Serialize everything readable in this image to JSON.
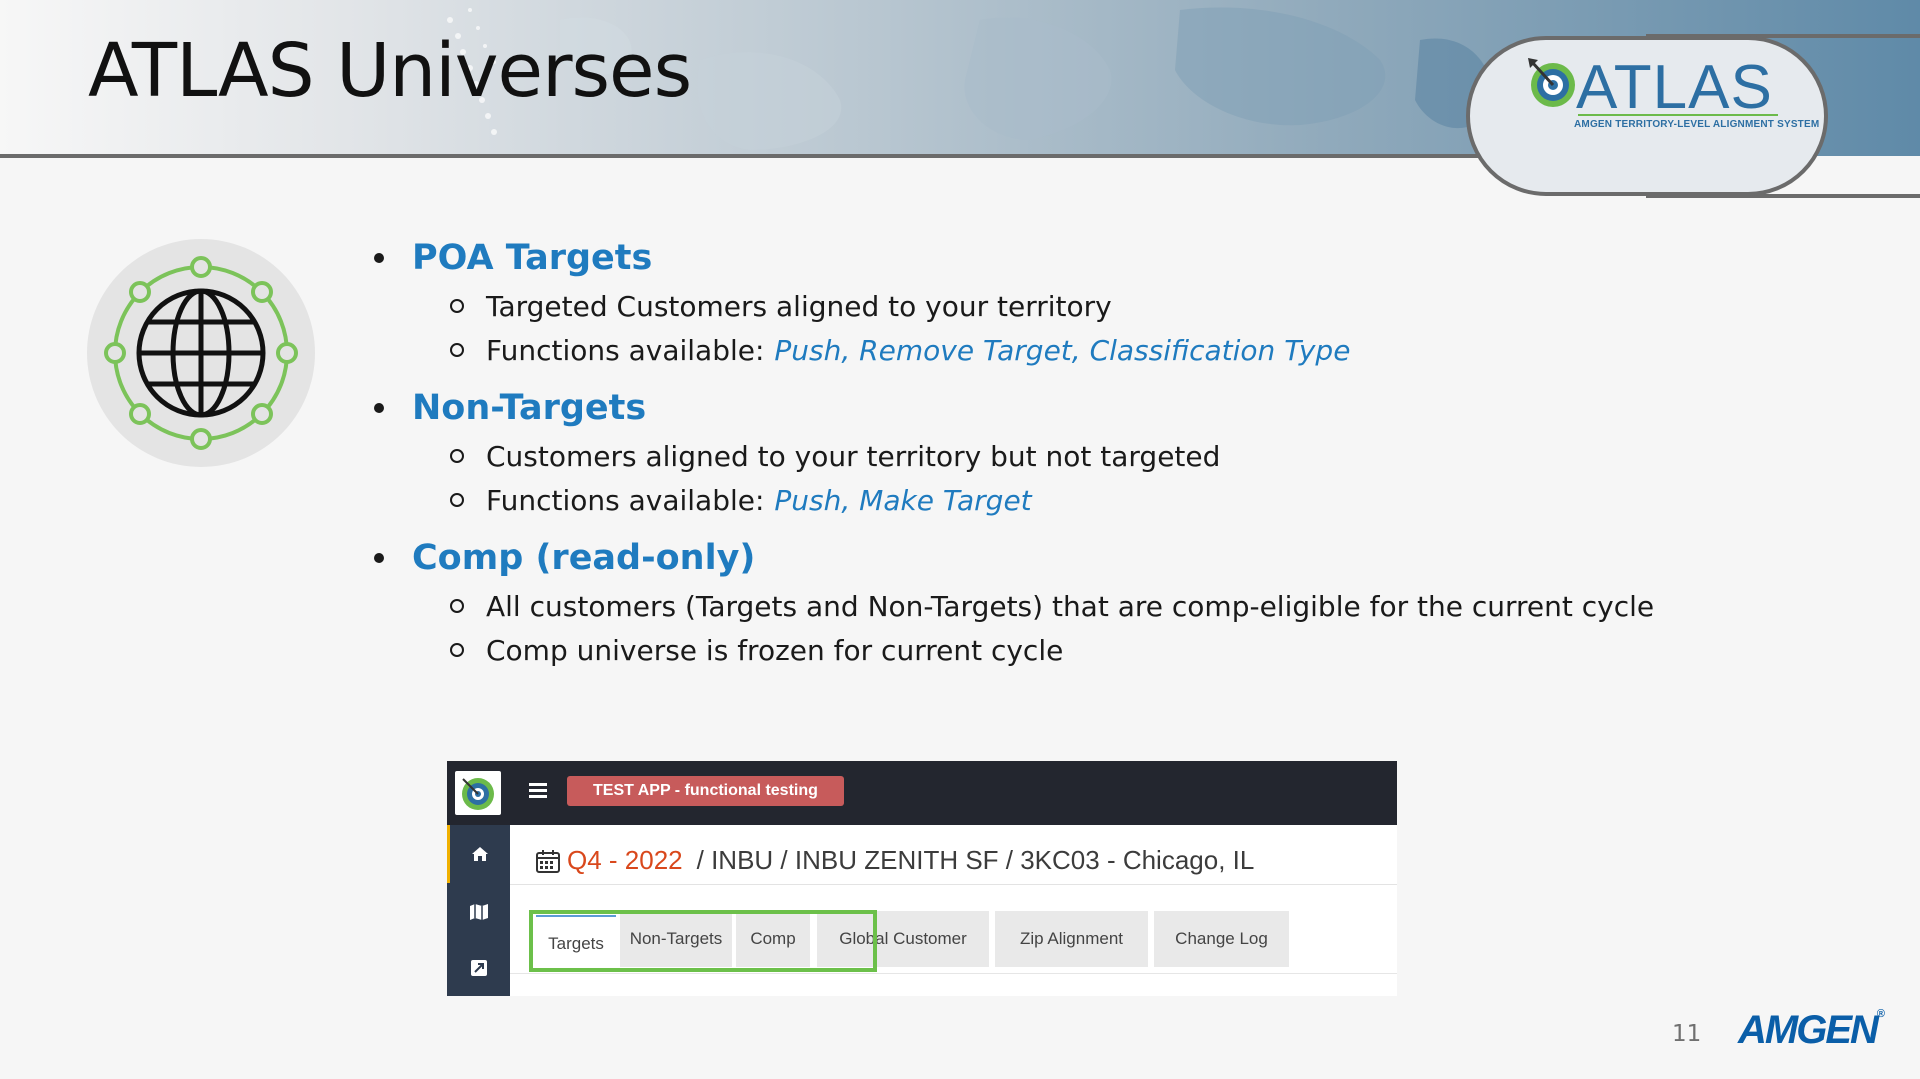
{
  "slide": {
    "title": "ATLAS Universes",
    "page_number": "11"
  },
  "logo": {
    "name": "ATLAS",
    "subtitle": "AMGEN TERRITORY-LEVEL ALIGNMENT SYSTEM"
  },
  "sections": [
    {
      "title": "POA Targets",
      "items": [
        {
          "text": "Targeted Customers aligned to your territory",
          "label": "",
          "functions": ""
        },
        {
          "text": "",
          "label": "Functions available:",
          "functions": "Push, Remove Target, Classification Type"
        }
      ]
    },
    {
      "title": "Non-Targets",
      "items": [
        {
          "text": "Customers aligned to your territory but not targeted",
          "label": "",
          "functions": ""
        },
        {
          "text": "",
          "label": "Functions available:",
          "functions": "Push, Make Target"
        }
      ]
    },
    {
      "title": "Comp (read-only)",
      "items": [
        {
          "text": "All customers (Targets and Non-Targets) that are comp-eligible for the current cycle",
          "label": "",
          "functions": ""
        },
        {
          "text": "Comp universe is frozen for current cycle",
          "label": "",
          "functions": ""
        }
      ]
    }
  ],
  "app": {
    "test_badge": "TEST APP - functional testing",
    "breadcrumb": {
      "period": "Q4 - 2022",
      "path": "/ INBU / INBU ZENITH SF / 3KC03 - Chicago, IL"
    },
    "tabs": [
      {
        "label": "Targets",
        "active": true
      },
      {
        "label": "Non-Targets",
        "active": false
      },
      {
        "label": "Comp",
        "active": false
      },
      {
        "label": "Global Customer",
        "active": false
      },
      {
        "label": "Zip Alignment",
        "active": false
      },
      {
        "label": "Change Log",
        "active": false
      }
    ],
    "sidebar_icons": [
      "home-icon",
      "map-icon",
      "external-link-icon"
    ]
  },
  "footer": {
    "brand": "AMGEN",
    "reg_mark": "®"
  },
  "colors": {
    "accent_blue": "#1f7bbf",
    "highlight_green": "#6cc04a",
    "period_orange": "#d9481c",
    "test_badge_red": "#c75b5b"
  }
}
